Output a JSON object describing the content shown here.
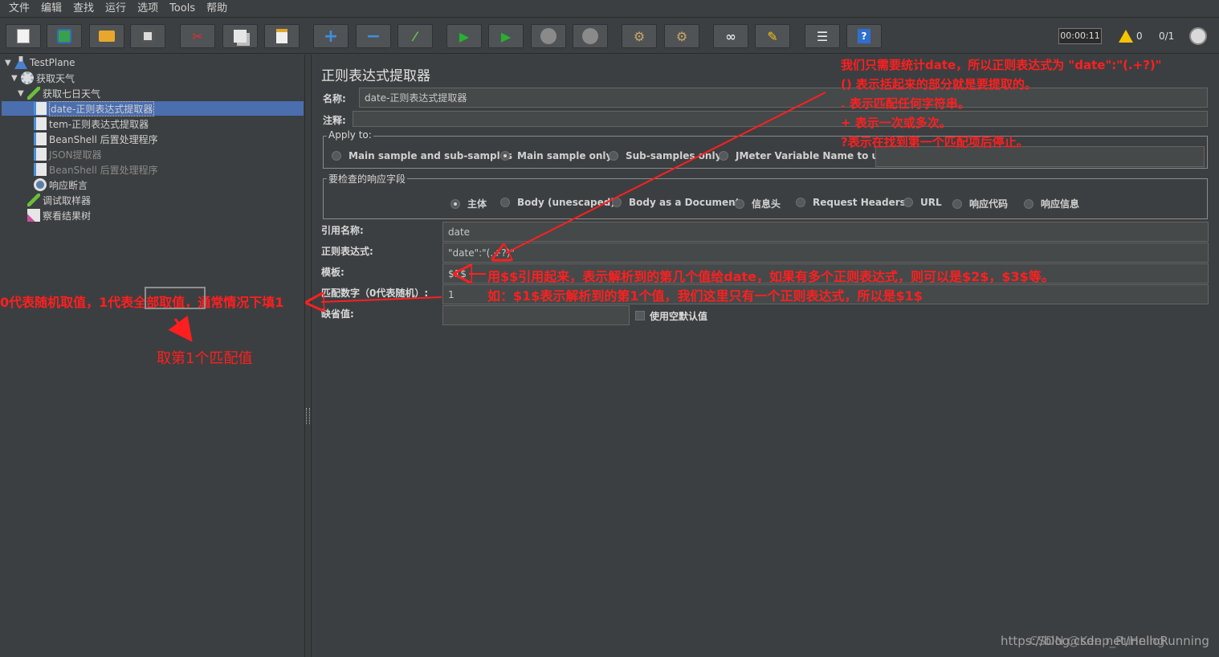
{
  "menu": [
    "文件",
    "编辑",
    "查找",
    "运行",
    "选项",
    "Tools",
    "帮助"
  ],
  "toolbar": {
    "timer": "00:00:11",
    "warnings": "0",
    "threads": "0/1",
    "icons": [
      "new-icon",
      "templates-icon",
      "open-icon",
      "save-icon",
      "cut-icon",
      "copy-icon",
      "paste-icon",
      "expand-icon",
      "collapse-icon",
      "toggle-icon",
      "start-icon",
      "start-no-pause-icon",
      "stop-icon",
      "shutdown-icon",
      "clear-icon",
      "clear-all-icon",
      "search-icon",
      "reset-search-icon",
      "function-helper-icon",
      "help-icon"
    ]
  },
  "tree": {
    "root": "TestPlane",
    "thread_group": "获取天气",
    "sampler": "获取七日天气",
    "children": [
      {
        "label": "date-正则表达式提取器",
        "selected": true,
        "disabled": false
      },
      {
        "label": "tem-正则表达式提取器",
        "selected": false,
        "disabled": false
      },
      {
        "label": "BeanShell 后置处理程序",
        "selected": false,
        "disabled": false
      },
      {
        "label": "JSON提取器",
        "selected": false,
        "disabled": true
      },
      {
        "label": "BeanShell 后置处理程序",
        "selected": false,
        "disabled": true
      }
    ],
    "assertion": "响应断言",
    "debug_sampler": "调试取样器",
    "listener": "察看结果树"
  },
  "panel": {
    "title": "正则表达式提取器",
    "name_label": "名称:",
    "name_value": "date-正则表达式提取器",
    "comment_label": "注释:",
    "comment_value": "",
    "apply_to": {
      "legend": "Apply to:",
      "options": [
        "Main sample and sub-samples",
        "Main sample only",
        "Sub-samples only",
        "JMeter Variable Name to use"
      ],
      "selected": 1,
      "var_value": ""
    },
    "field_to_check": {
      "legend": "要检查的响应字段",
      "options": [
        "主体",
        "Body (unescaped)",
        "Body as a Document",
        "信息头",
        "Request Headers",
        "URL",
        "响应代码",
        "响应信息"
      ],
      "selected": 0
    },
    "ref_name_label": "引用名称:",
    "ref_name_value": "date",
    "regex_label": "正则表达式:",
    "regex_value": "\"date\":\"(.+?)\"",
    "template_label": "模板:",
    "template_value": "$1$",
    "match_no_label": "匹配数字（0代表随机）:",
    "match_no_value": "1",
    "default_label": "缺省值:",
    "default_value": "",
    "empty_default_label": "使用空默认值"
  },
  "annotations": {
    "regex_notes": [
      "我们只需要统计date，所以正则表达式为 \"date\":\"(.+?)\"",
      "() 表示括起来的部分就是要提取的。",
      ". 表示匹配任何字符串。",
      "+ 表示一次或多次。",
      "?表示在找到第一个匹配项后停止。"
    ],
    "template_notes": [
      "用$$引用起来，表示解析到的第几个值给date，如果有多个正则表达式，则可以是$2$，$3$等。",
      "如：$1$表示解析到的第1个值，我们这里只有一个正则表达式，所以是$1$"
    ],
    "match_note_pre": "0代表随机取值，1代表",
    "match_note_box": "全部取值",
    "match_note_post": "，通常情况下填1",
    "match_note_result": "取第1个匹配值"
  },
  "watermark": "https://blog.csdn.net/HelloRunning",
  "watermark_overlay": "CSDN @Keep_Running"
}
